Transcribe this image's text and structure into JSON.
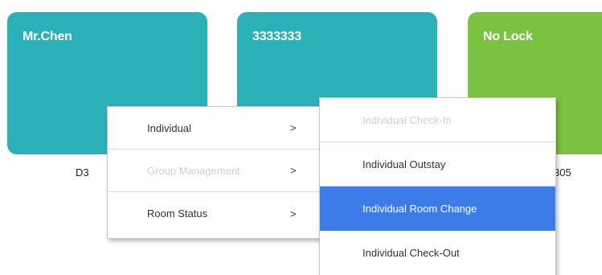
{
  "rooms": [
    {
      "name": "Mr.Chen",
      "number_visible": "D3",
      "color": "#2bb1b8"
    },
    {
      "name": "3333333",
      "number_visible": "",
      "color": "#2bb1b8"
    },
    {
      "name": "No Lock",
      "number_visible": "305",
      "color": "#7bc142"
    }
  ],
  "context_menu": {
    "items": [
      {
        "label": "Individual",
        "arrow": ">",
        "enabled": true
      },
      {
        "label": "Group Management",
        "arrow": ">",
        "enabled": false
      },
      {
        "label": "Room Status",
        "arrow": ">",
        "enabled": true
      }
    ]
  },
  "submenu": {
    "items": [
      {
        "label": "Individual Check-In",
        "enabled": false,
        "selected": false
      },
      {
        "label": "Individual Outstay",
        "enabled": true,
        "selected": false
      },
      {
        "label": "Individual Room Change",
        "enabled": true,
        "selected": true
      },
      {
        "label": "Individual Check-Out",
        "enabled": true,
        "selected": false
      }
    ]
  },
  "colors": {
    "teal": "#2bb1b8",
    "green": "#7bc142",
    "highlight": "#3d7ce8",
    "disabled_text": "#cfcfcf"
  }
}
